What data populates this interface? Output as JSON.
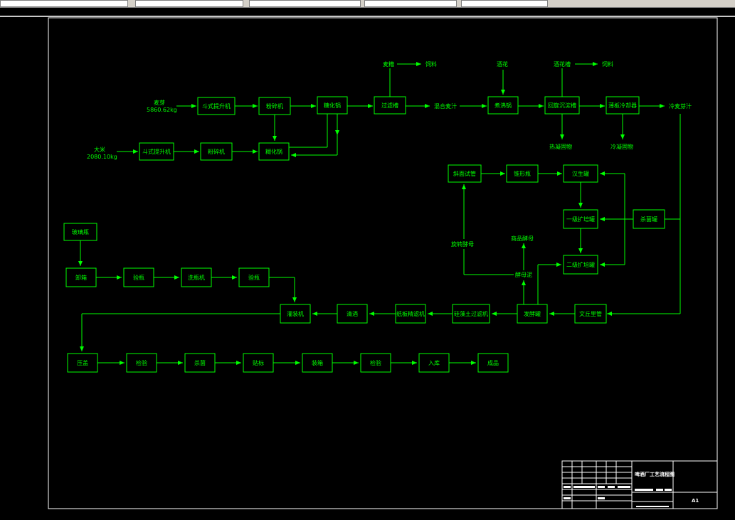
{
  "nodes": {
    "maiya": "麦芽",
    "maiya_w": "5860.62kg",
    "dami": "大米",
    "dami_w": "2080.10kg",
    "dsts1": "斗式提升机",
    "dsts2": "斗式提升机",
    "fsj1": "粉碎机",
    "fsj2": "粉碎机",
    "thg1": "糖化锅",
    "thg2": "糊化锅",
    "glc": "过滤槽",
    "maizao": "麦糟",
    "siliao1": "饲料",
    "hunhe": "混合麦汁",
    "zhufei": "煮沸锅",
    "jiuhua1": "酒花",
    "jiuhua2": "酒花槽",
    "siliao2": "饲料",
    "xuanchen": "回旋沉淀槽",
    "rening": "热凝固物",
    "bojing": "薄板冷却器",
    "lening": "冷凝固物",
    "lengmaizhi": "冷麦芽汁",
    "xiejun": "斜面试管",
    "sanjiao": "锥形瓶",
    "hanjun": "汉生罐",
    "yiji": "一级扩培罐",
    "erji": "二级扩培罐",
    "yeyang": "杀菌罐",
    "xuanzhuan": "旋转酵母",
    "shangpin": "商品酵母",
    "jiaomuni": "酵母泥",
    "fajiao": "发酵罐",
    "wenqiu": "文丘里管",
    "gltg": "硅藻土过滤机",
    "mobanguo": "纸板精滤机",
    "qingjiu": "清酒",
    "guanzhuang": "灌装机",
    "boliping": "玻璃瓶",
    "xiping": "卸箱",
    "jianping": "验瓶",
    "xipingji": "洗瓶机",
    "jianping2": "验瓶",
    "yasai": "压盖",
    "jianyan": "检验",
    "shajun": "杀菌",
    "tiebiao": "贴标",
    "zhuangxiang": "装箱",
    "jianyan2": "检验",
    "rucang": "入库",
    "chengpin": "成品"
  },
  "titleblock": {
    "title": "啤酒厂工艺流程图",
    "number": "A1"
  },
  "colors": {
    "line": "#00ff00",
    "background": "#000000",
    "border": "#ffffff"
  }
}
